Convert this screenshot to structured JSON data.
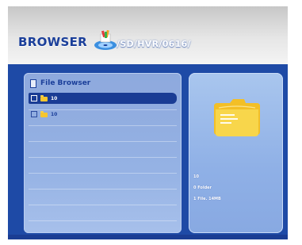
{
  "header": {
    "title": "BROWSER",
    "path": "/SD/HVR/0616/",
    "icon": "media-browser-icon"
  },
  "left_panel": {
    "title": "File Browser",
    "rows": [
      {
        "label": "10",
        "selected": true,
        "icon": "folder-icon"
      },
      {
        "label": "10",
        "selected": false,
        "icon": "folder-icon"
      }
    ]
  },
  "right_panel": {
    "preview_icon": "folder-icon",
    "info": {
      "name": "10",
      "type": "0 Folder",
      "files": "1 File.  14MB"
    }
  },
  "colors": {
    "screen_blue": "#1e4aa6",
    "title_blue": "#1b3f9a",
    "panel_blue": "#95b2e4",
    "folder_yellow": "#f6c62f"
  }
}
